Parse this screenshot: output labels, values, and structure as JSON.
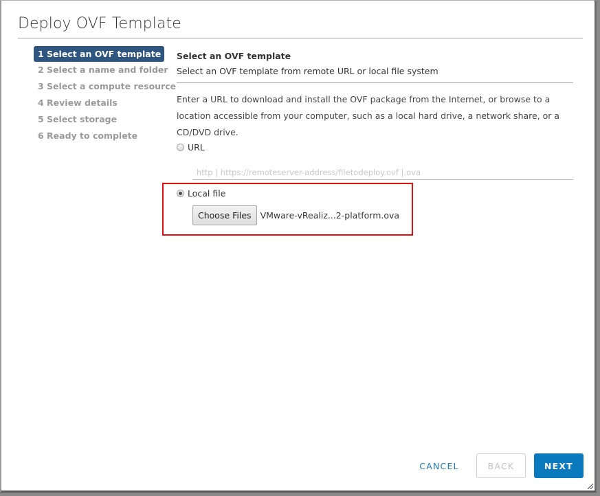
{
  "dialog": {
    "title": "Deploy OVF Template"
  },
  "steps": [
    {
      "label": "1 Select an OVF template",
      "active": true
    },
    {
      "label": "2 Select a name and folder",
      "active": false
    },
    {
      "label": "3 Select a compute resource",
      "active": false
    },
    {
      "label": "4 Review details",
      "active": false
    },
    {
      "label": "5 Select storage",
      "active": false
    },
    {
      "label": "6 Ready to complete",
      "active": false
    }
  ],
  "content": {
    "section_title": "Select an OVF template",
    "section_subtitle": "Select an OVF template from remote URL or local file system",
    "description": "Enter a URL to download and install the OVF package from the Internet, or browse to a location accessible from your computer, such as a local hard drive, a network share, or a CD/DVD drive.",
    "url_option": {
      "label": "URL",
      "selected": false,
      "input_value": "",
      "input_placeholder": "http | https://remoteserver-address/filetodeploy.ovf |.ova"
    },
    "local_option": {
      "label": "Local file",
      "selected": true,
      "choose_button_label": "Choose Files",
      "selected_file": "VMware-vRealiz...2-platform.ova"
    }
  },
  "footer": {
    "cancel_label": "CANCEL",
    "back_label": "BACK",
    "next_label": "NEXT"
  },
  "colors": {
    "active_step_bg": "#2f567e",
    "primary_button": "#0a79bd",
    "link_text": "#1b7ab8",
    "highlight_border": "#e01010"
  }
}
